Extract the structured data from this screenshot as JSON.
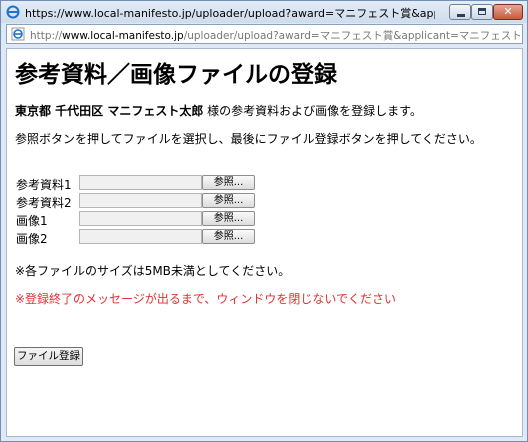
{
  "window": {
    "title": "https://www.local-manifesto.jp/uploader/upload?award=マニフェスト賞&applicant=マ..."
  },
  "address": {
    "prefix": "http://",
    "host": "www.local-manifesto.jp",
    "rest": "/uploader/upload?award=マニフェスト賞&applicant=マニフェスト太郎&todo"
  },
  "page": {
    "heading": "参考資料／画像ファイルの登録",
    "applicant_bold": "東京都 千代田区 マニフェスト太郎",
    "applicant_suffix": " 様の参考資料および画像を登録します。",
    "instruction": "参照ボタンを押してファイルを選択し、最後にファイル登録ボタンを押してください。",
    "fields": [
      {
        "label": "参考資料1",
        "button": "参照..."
      },
      {
        "label": "参考資料2",
        "button": "参照..."
      },
      {
        "label": "画像1",
        "button": "参照..."
      },
      {
        "label": "画像2",
        "button": "参照..."
      }
    ],
    "size_note": "※各ファイルのサイズは5MB未満としてください。",
    "warning": "※登録終了のメッセージが出るまで、ウィンドウを閉じないでください",
    "submit_label": "ファイル登録"
  },
  "colors": {
    "warning": "#e03232"
  },
  "icons": [
    "ie-page-icon",
    "ie-address-icon",
    "minimize-icon",
    "maximize-icon",
    "close-icon"
  ]
}
